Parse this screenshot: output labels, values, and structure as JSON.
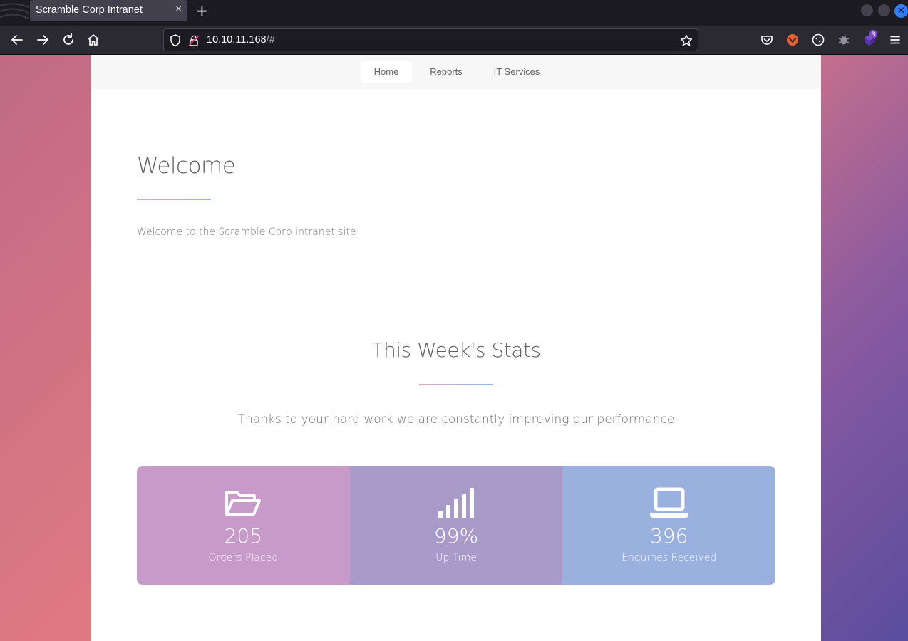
{
  "browser": {
    "tab_title": "Scramble Corp Intranet",
    "tab_close": "×",
    "new_tab": "+",
    "url_host": "10.10.11.168",
    "url_path": "/#",
    "extension_badge": "3"
  },
  "site_nav": {
    "items": [
      {
        "label": "Home",
        "active": true
      },
      {
        "label": "Reports",
        "active": false
      },
      {
        "label": "IT Services",
        "active": false
      }
    ]
  },
  "welcome": {
    "title": "Welcome",
    "text": "Welcome to the Scramble Corp intranet site"
  },
  "stats": {
    "title": "This Week's Stats",
    "subtitle": "Thanks to your hard work we are constantly improving our performance",
    "items": [
      {
        "icon": "folder-open-icon",
        "value": "205",
        "label": "Orders Placed",
        "color": "#c79ac9"
      },
      {
        "icon": "signal-icon",
        "value": "99%",
        "label": "Up Time",
        "color": "#a99bc9"
      },
      {
        "icon": "laptop-icon",
        "value": "396",
        "label": "Enquiries Received",
        "color": "#9ab0df"
      }
    ]
  },
  "colors": {
    "accent_gradient_start": "#e0a8c4",
    "accent_gradient_end": "#8fb6e4"
  }
}
